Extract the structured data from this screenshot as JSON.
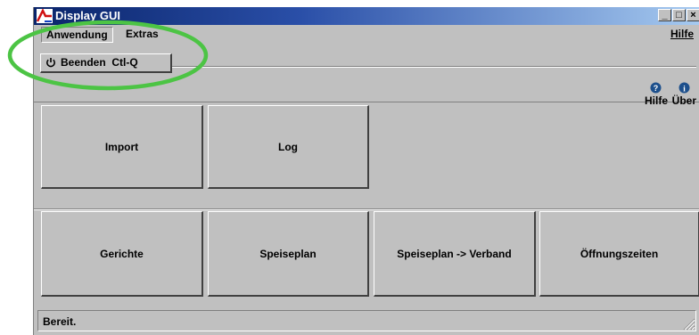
{
  "window": {
    "title": "Display GUI",
    "controls": [
      "_",
      "□",
      "×"
    ]
  },
  "menubar": {
    "items": [
      "Anwendung",
      "Extras"
    ],
    "help": "Hilfe"
  },
  "dropdown": {
    "item_label": "Beenden  Ctl-Q"
  },
  "toolbar": {
    "help_label": "Hilfe",
    "about_label": "Über"
  },
  "buttons_row1": [
    "Import",
    "Log"
  ],
  "buttons_row2": [
    "Gerichte",
    "Speiseplan",
    "Speiseplan -> Verband",
    "Öffnungszeiten"
  ],
  "statusbar": {
    "text": "Bereit."
  },
  "colors": {
    "annotation": "#4cc444",
    "titlebar": "#0a246a",
    "help_icon": "#1c4f8c"
  },
  "icons": {
    "app": "app-logo-icon",
    "quit": "power-icon",
    "help": "help-icon",
    "about": "info-icon"
  }
}
